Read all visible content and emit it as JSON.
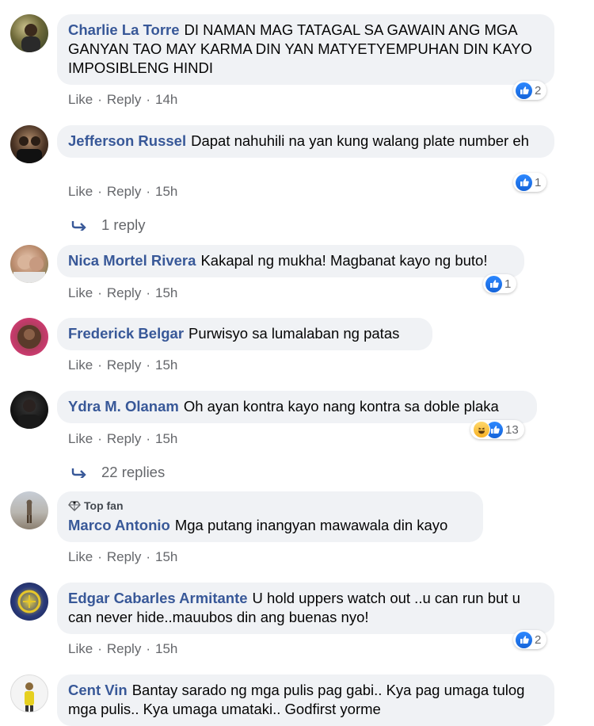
{
  "action_labels": {
    "like": "Like",
    "reply": "Reply",
    "dot": "·"
  },
  "comments": [
    {
      "author": "Charlie La Torre",
      "text": "DI NAMAN MAG TATAGAL SA GAWAIN ANG MGA GANYAN TAO MAY KARMA DIN YAN MATYETYEMPUHAN DIN KAYO IMPOSIBLENG HINDI",
      "time": "14h",
      "reaction_count": "2"
    },
    {
      "author": "Jefferson Russel",
      "text": "Dapat nahuhili na yan kung walang plate number eh",
      "time": "15h",
      "reaction_count": "1",
      "replies_label": "1 reply"
    },
    {
      "author": "Nica Mortel Rivera",
      "text": "Kakapal ng mukha! Magbanat kayo ng buto!",
      "time": "15h",
      "reaction_count": "1"
    },
    {
      "author": "Frederick Belgar",
      "text": "Purwisyo sa lumalaban ng patas",
      "time": "15h"
    },
    {
      "author": "Ydra M. Olanam",
      "text": "Oh ayan kontra kayo nang kontra sa doble plaka",
      "time": "15h",
      "reaction_count": "13",
      "replies_label": "22 replies"
    },
    {
      "author": "Marco Antonio",
      "badge": "Top fan",
      "text": "Mga putang inangyan mawawala din kayo",
      "time": "15h"
    },
    {
      "author": "Edgar Cabarles Armitante",
      "text": "U hold uppers watch out ..u can run but u can never hide..mauubos din ang buenas nyo!",
      "time": "15h",
      "reaction_count": "2"
    },
    {
      "author": "Cent Vin",
      "text": "Bantay sarado ng mga pulis pag gabi.. Kya pag umaga tulog mga pulis.. Kya umaga umataki.. Godfirst yorme"
    }
  ],
  "colors": {
    "author": "#385898",
    "bubble": "#f0f2f5",
    "like_blue": "#1877f2",
    "meta": "#65676b"
  }
}
